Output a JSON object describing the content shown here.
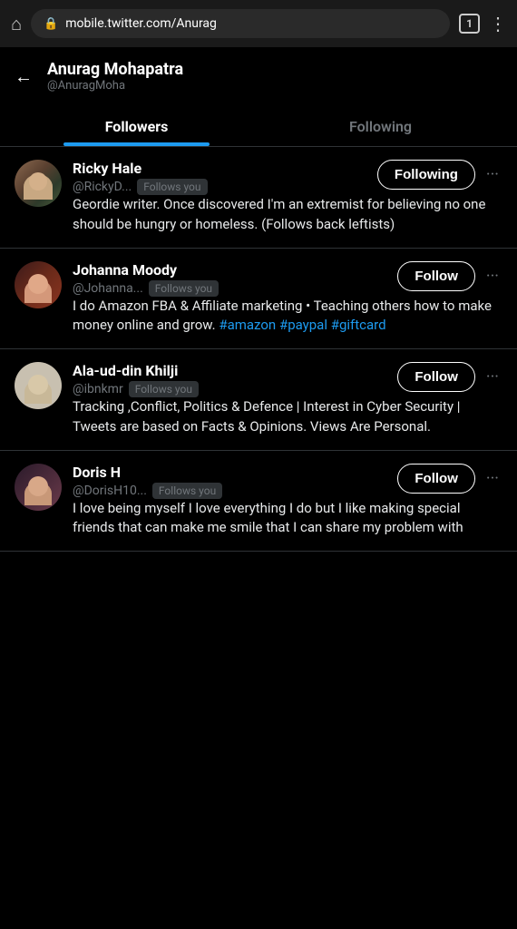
{
  "browser": {
    "url": "mobile.twitter.com/Anurag",
    "tab_count": "1",
    "home_icon": "⌂",
    "lock_icon": "🔒",
    "menu_icon": "⋮"
  },
  "header": {
    "back_label": "←",
    "name": "Anurag Mohapatra",
    "handle": "@AnuragMoha",
    "tab_followers": "Followers",
    "tab_following": "Following"
  },
  "users": [
    {
      "id": "ricky",
      "name": "Ricky Hale",
      "handle": "@RickyD...",
      "follows_you": "Follows you",
      "action": "Following",
      "action_type": "following",
      "bio": "Geordie writer. Once discovered I'm an extremist for believing no one should be hungry or homeless. (Follows back leftists)"
    },
    {
      "id": "johanna",
      "name": "Johanna Moody",
      "handle": "@Johanna...",
      "follows_you": "Follows you",
      "action": "Follow",
      "action_type": "follow",
      "bio_plain": "I do Amazon FBA & Affiliate marketing • Teaching others how to make money online and grow. ",
      "bio_tags": "#amazon #paypal #giftcard"
    },
    {
      "id": "ala",
      "name": "Ala-ud-din Khilji",
      "handle": "@ibnkmr",
      "follows_you": "Follows you",
      "action": "Follow",
      "action_type": "follow",
      "bio": "Tracking ,Conflict, Politics & Defence | Interest in Cyber Security | Tweets are based on Facts & Opinions. Views Are Personal."
    },
    {
      "id": "doris",
      "name": "Doris H",
      "handle": "@DorisH10...",
      "follows_you": "Follows you",
      "action": "Follow",
      "action_type": "follow",
      "bio": "I love being myself I love everything I do but I like making special friends that can make me smile that I can share my problem with"
    }
  ]
}
